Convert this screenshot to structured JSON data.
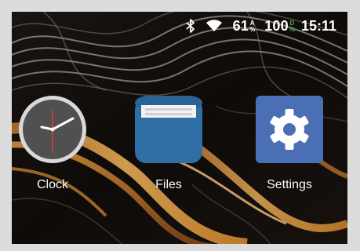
{
  "status_bar": {
    "icons": [
      "bluetooth-icon",
      "wifi-icon"
    ],
    "signal_value": "61",
    "signal_top": "A",
    "signal_bottom": "%",
    "battery_value": "100",
    "battery_top": "D",
    "battery_bottom": "%",
    "time": "15:11"
  },
  "apps": [
    {
      "label": "Clock",
      "icon": "clock-icon"
    },
    {
      "label": "Files",
      "icon": "files-icon"
    },
    {
      "label": "Settings",
      "icon": "settings-icon"
    }
  ],
  "colors": {
    "files_blue": "#2f6fa6",
    "settings_blue": "#4a6fb5",
    "clock_face": "#505050",
    "battery_indicator": "#4caf50"
  }
}
